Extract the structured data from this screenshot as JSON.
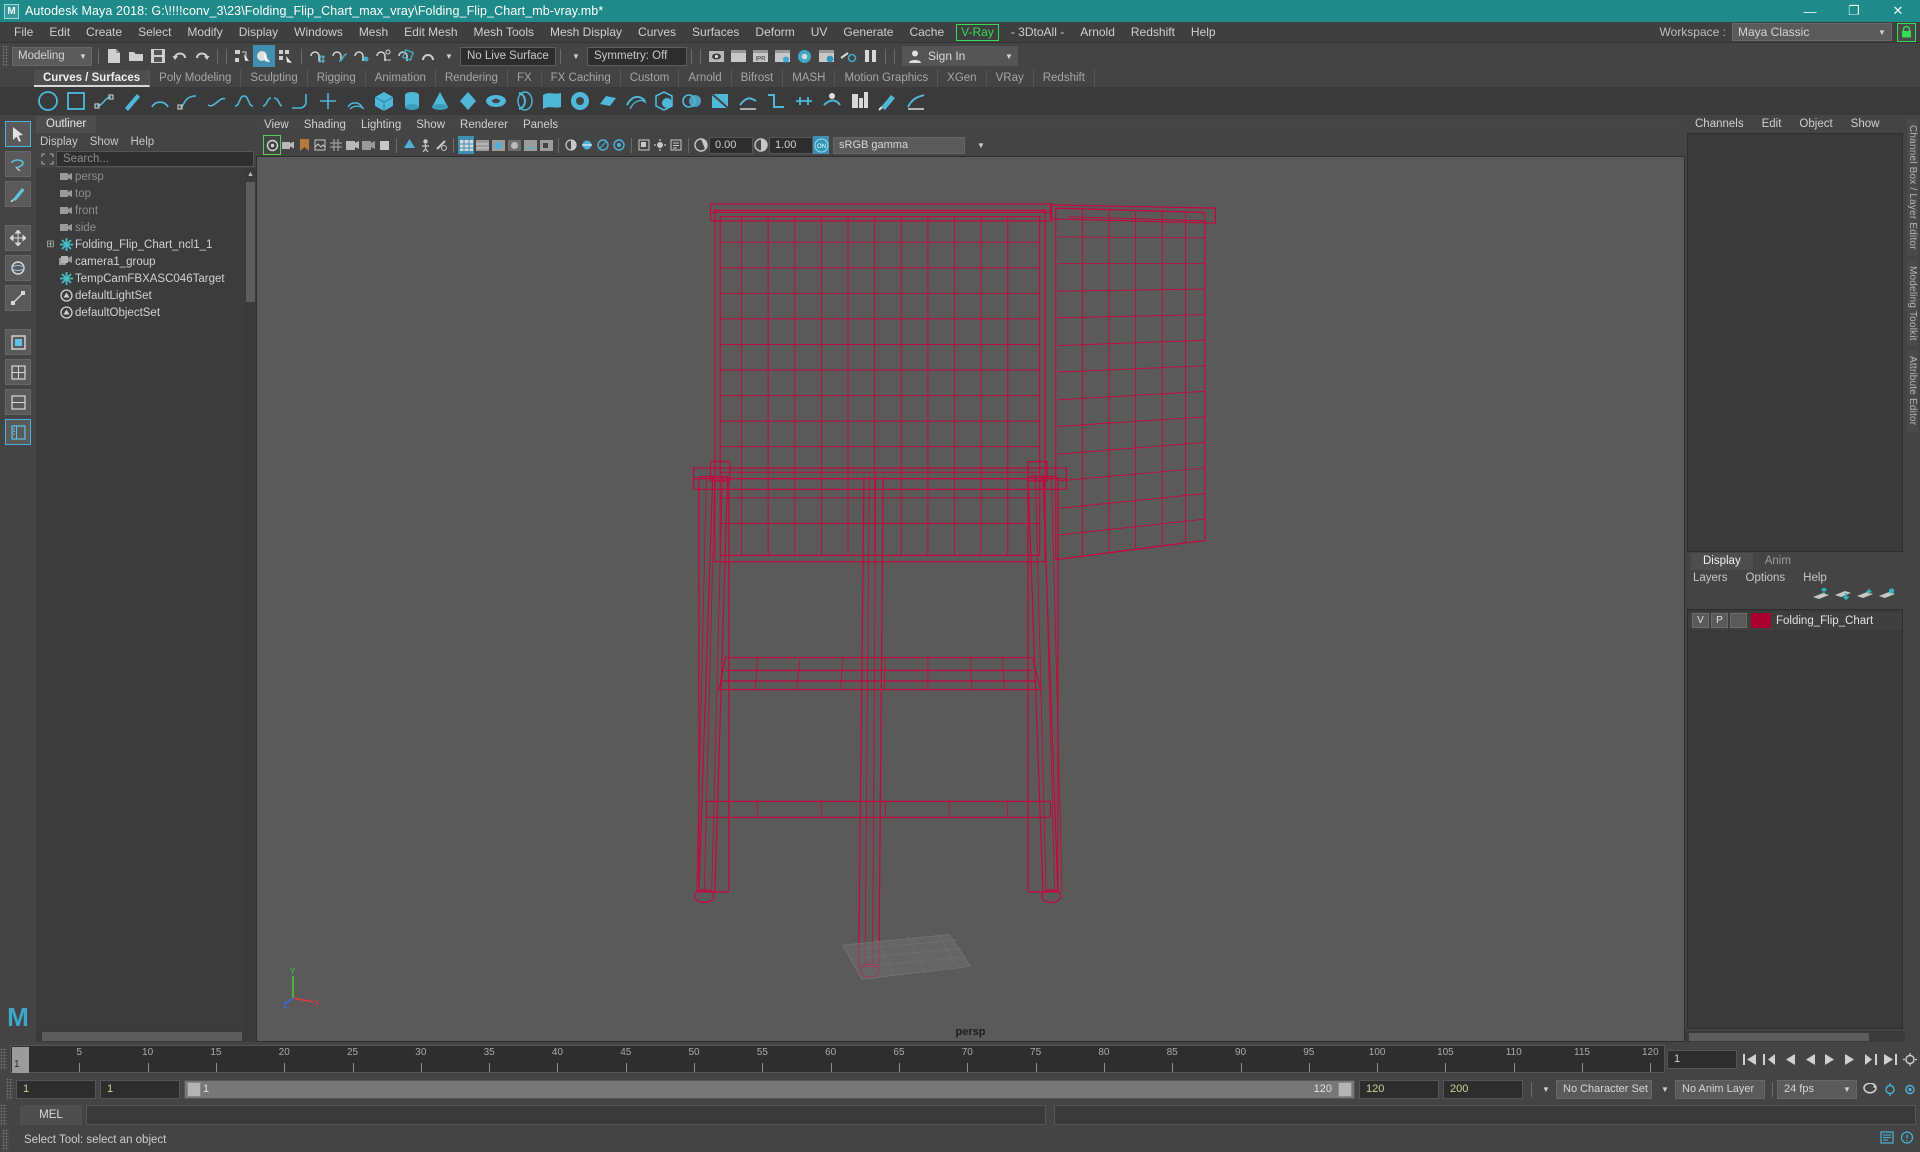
{
  "titlebar": {
    "app_title": "Autodesk Maya 2018: G:\\!!!!conv_3\\23\\Folding_Flip_Chart_max_vray\\Folding_Flip_Chart_mb-vray.mb*",
    "logo_text": "M",
    "minimize": "—",
    "maximize": "❐",
    "close": "✕",
    "bg_color": "#1e8a8a"
  },
  "menubar": {
    "items": [
      "File",
      "Edit",
      "Create",
      "Select",
      "Modify",
      "Display",
      "Windows",
      "Mesh",
      "Edit Mesh",
      "Mesh Tools",
      "Mesh Display",
      "Curves",
      "Surfaces",
      "Deform",
      "UV",
      "Generate",
      "Cache"
    ],
    "highlighted_item": "V-Ray",
    "highlight_color": "#33dd55",
    "items_after": [
      "- 3DtoAll -",
      "Arnold",
      "Redshift",
      "Help"
    ],
    "workspace_label": "Workspace :",
    "workspace_value": "Maya Classic",
    "lock_icon": "lock-icon"
  },
  "statusline": {
    "menu_set": "Modeling",
    "live_surface": "No Live Surface",
    "symmetry": "Symmetry: Off",
    "signin": "Sign In",
    "file_icons": [
      "new-scene-icon",
      "open-scene-icon",
      "save-scene-icon",
      "undo-icon",
      "redo-icon"
    ],
    "select_icons": [
      "select-hierarchy-icon",
      "select-object-icon",
      "select-component-icon"
    ],
    "snap_icons": [
      "snap-grid-icon",
      "snap-curve-icon",
      "snap-point-icon",
      "snap-projected-icon",
      "snap-view-plane-icon",
      "magnet-icon"
    ],
    "render_icons": [
      "render-view-icon",
      "render-current-frame-icon",
      "ipr-icon",
      "render-settings-icon",
      "hypershade-icon",
      "render-setup-icon",
      "light-editor-icon",
      "pause-icon"
    ]
  },
  "shelf": {
    "tabs": [
      "Curves / Surfaces",
      "Poly Modeling",
      "Sculpting",
      "Rigging",
      "Animation",
      "Rendering",
      "FX",
      "FX Caching",
      "Custom",
      "Arnold",
      "Bifrost",
      "MASH",
      "Motion Graphics",
      "XGen",
      "VRay",
      "Redshift"
    ],
    "selected_tab": "Curves / Surfaces",
    "icons": [
      "circle-curve-icon",
      "square-curve-icon",
      "cv-curve-icon",
      "pencil-curve-icon",
      "arc-curve-icon",
      "bezier-curve-icon",
      "ep-curve-icon",
      "attach-curve-icon",
      "detach-curve-icon",
      "curve-fillet-icon",
      "cut-curve-icon",
      "offset-curve-icon",
      "sphere-icon",
      "cylinder-icon",
      "cone-icon",
      "torus-icon",
      "plane-icon",
      "revolve-icon",
      "loft-icon",
      "planar-icon",
      "extrude-icon",
      "birail-icon",
      "boolean-icon",
      "intersect-icon",
      "trim-icon",
      "untrim-icon",
      "project-curve-icon",
      "surface-fillet-icon",
      "stitch-icon",
      "sculpt-surface-icon",
      "rebuild-surface-icon",
      "nurbs-to-poly-icon"
    ]
  },
  "toolbox": {
    "tools": [
      "select-tool",
      "lasso-select-tool",
      "paint-select-tool",
      "move-tool",
      "rotate-tool",
      "scale-tool",
      "last-tool",
      "show-manipulator-tool",
      "layout-single-icon",
      "layout-four-icon",
      "layout-two-stacked-icon",
      "layout-outliner-persp-icon"
    ],
    "selected_tool": "select-tool",
    "logo": "maya-logo"
  },
  "outliner": {
    "tab": "Outliner",
    "menus": [
      "Display",
      "Show",
      "Help"
    ],
    "search_placeholder": "Search...",
    "items": [
      {
        "label": "persp",
        "icon": "camera-icon",
        "dim": true,
        "expand": ""
      },
      {
        "label": "top",
        "icon": "camera-icon",
        "dim": true,
        "expand": ""
      },
      {
        "label": "front",
        "icon": "camera-icon",
        "dim": true,
        "expand": ""
      },
      {
        "label": "side",
        "icon": "camera-icon",
        "dim": true,
        "expand": ""
      },
      {
        "label": "Folding_Flip_Chart_ncl1_1",
        "icon": "transform-icon",
        "dim": false,
        "expand": "⊞"
      },
      {
        "label": "camera1_group",
        "icon": "camera-group-icon",
        "dim": false,
        "expand": ""
      },
      {
        "label": "TempCamFBXASC046Target",
        "icon": "transform-icon",
        "dim": false,
        "expand": ""
      },
      {
        "label": "defaultLightSet",
        "icon": "set-icon",
        "dim": false,
        "expand": ""
      },
      {
        "label": "defaultObjectSet",
        "icon": "set-icon",
        "dim": false,
        "expand": ""
      }
    ]
  },
  "viewport": {
    "menus": [
      "View",
      "Shading",
      "Lighting",
      "Show",
      "Renderer",
      "Panels"
    ],
    "exposure_value": "0.00",
    "gamma_value": "1.00",
    "color_profile": "sRGB gamma",
    "camera_label": "persp",
    "background_color": "#5a5a5a",
    "model_color": "#d1003c",
    "axis_labels": {
      "y": "Y",
      "x": "X",
      "z": "Z"
    }
  },
  "right_dock": {
    "channelbox_menus": [
      "Channels",
      "Edit",
      "Object",
      "Show"
    ],
    "vertical_tabs": [
      "Channel Box / Layer Editor",
      "Modeling Toolkit",
      "Attribute Editor"
    ],
    "layers_tabs": [
      "Display",
      "Anim"
    ],
    "layers_selected_tab": "Display",
    "layers_menus": [
      "Layers",
      "Options",
      "Help"
    ],
    "layer_buttons": [
      "move-layer-up-icon",
      "move-layer-down-icon",
      "new-layer-icon",
      "new-layer-from-selected-icon"
    ],
    "layers": [
      {
        "visible": "V",
        "playback": "P",
        "shading": "",
        "color": "#aa0030",
        "name": "Folding_Flip_Chart"
      }
    ]
  },
  "timeline": {
    "current_frame": "1",
    "tick_labels": [
      "5",
      "10",
      "15",
      "20",
      "25",
      "30",
      "35",
      "40",
      "45",
      "50",
      "55",
      "60",
      "65",
      "70",
      "75",
      "80",
      "85",
      "90",
      "95",
      "100",
      "105",
      "110",
      "115",
      "120"
    ],
    "end_field": "1",
    "playback_icons": [
      "go-to-start-icon",
      "step-back-key-icon",
      "step-back-frame-icon",
      "play-backwards-icon",
      "play-forwards-icon",
      "step-forward-frame-icon",
      "step-forward-key-icon",
      "go-to-end-icon"
    ],
    "anim_prefs_icon": "animation-preferences-icon",
    "range_start": "1",
    "range_end": "1",
    "slider_start": "1",
    "slider_end": "120",
    "playback_end": "120",
    "playback_max": "200",
    "character_set": "No Character Set",
    "anim_layer": "No Anim Layer",
    "fps": "24 fps",
    "loop_icon": "playback-loop-icon",
    "prefs_icon": "preferences-icon",
    "settings_icon": "animation-settings-icon"
  },
  "command_line": {
    "mode": "MEL",
    "input_value": "",
    "status_message": "Select Tool: select an object"
  }
}
